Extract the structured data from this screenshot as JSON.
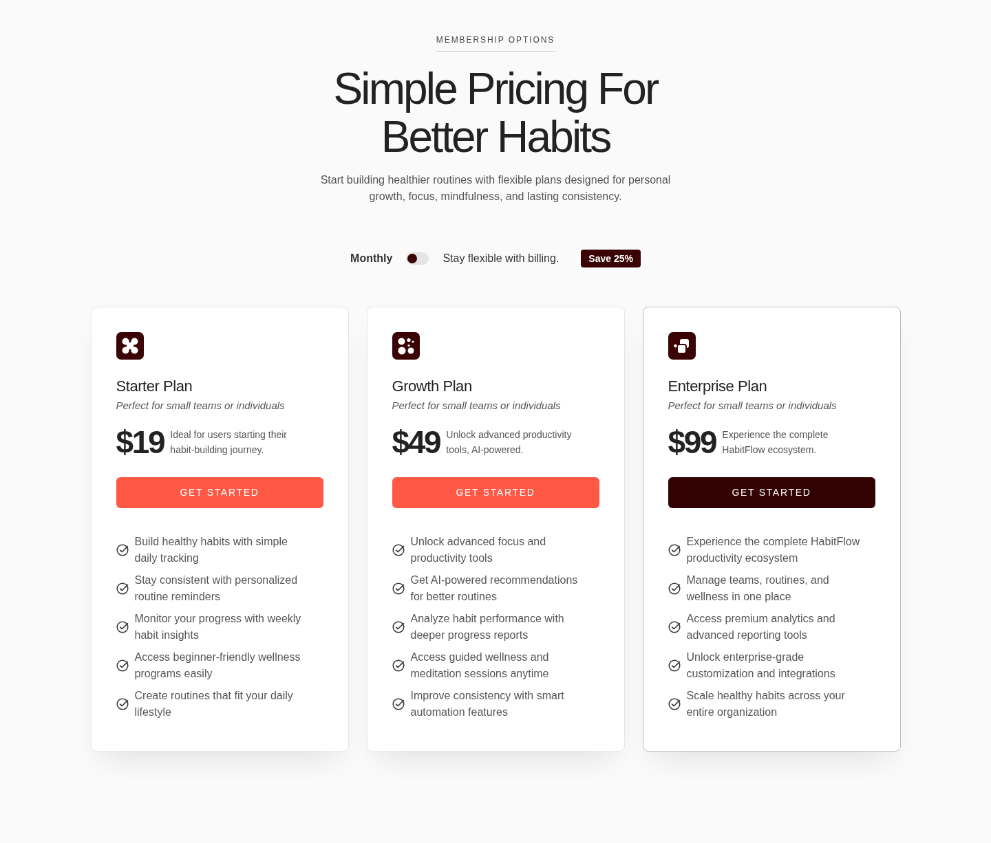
{
  "header": {
    "eyebrow": "MEMBERSHIP OPTIONS",
    "title": "Simple Pricing For Better Habits",
    "subtitle": "Start building healthier routines with flexible plans designed for personal growth, focus, mindfulness, and lasting consistency."
  },
  "billing": {
    "label": "Monthly",
    "toggle_on": false,
    "note": "Stay flexible with billing.",
    "badge": "Save 25%"
  },
  "plans": [
    {
      "name": "Starter Plan",
      "tagline": "Perfect for small teams or individuals",
      "price": "$19",
      "price_note": "Ideal for users starting their habit-building journey.",
      "button": "GET STARTED",
      "featured": false,
      "features": [
        "Build healthy habits with simple daily tracking",
        "Stay consistent with personalized routine reminders",
        "Monitor your progress with weekly habit insights",
        "Access beginner-friendly wellness programs easily",
        "Create routines that fit your daily lifestyle"
      ]
    },
    {
      "name": "Growth Plan",
      "tagline": "Perfect for small teams or individuals",
      "price": "$49",
      "price_note": "Unlock advanced productivity tools, AI-powered.",
      "button": "GET STARTED",
      "featured": false,
      "features": [
        "Unlock advanced focus and productivity tools",
        "Get AI-powered recommendations for better routines",
        "Analyze habit performance with deeper progress reports",
        "Access guided wellness and meditation sessions anytime",
        "Improve consistency with smart automation features"
      ]
    },
    {
      "name": "Enterprise Plan",
      "tagline": "Perfect for small teams or individuals",
      "price": "$99",
      "price_note": "Experience the complete HabitFlow ecosystem.",
      "button": "GET STARTED",
      "featured": true,
      "features": [
        "Experience the complete HabitFlow productivity ecosystem",
        "Manage teams, routines, and wellness in one place",
        "Access premium analytics and advanced reporting tools",
        "Unlock enterprise-grade customization and integrations",
        "Scale healthy habits across your entire organization"
      ]
    }
  ]
}
